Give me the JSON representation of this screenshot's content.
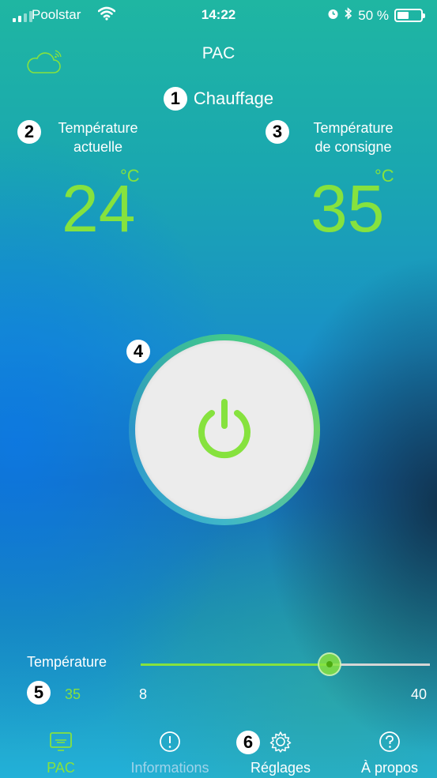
{
  "status": {
    "carrier": "Poolstar",
    "time": "14:22",
    "battery": "50 %",
    "battery_level_percent": 50
  },
  "header": {
    "title": "PAC",
    "cloud_icon": "cloud-wifi-icon"
  },
  "badges": [
    "1",
    "2",
    "3",
    "4",
    "5",
    "6"
  ],
  "mode": {
    "label": "Chauffage"
  },
  "current_temp": {
    "label_line1": "Température",
    "label_line2": "actuelle",
    "value": "24",
    "unit": "°C"
  },
  "target_temp": {
    "label_line1": "Température",
    "label_line2": "de consigne",
    "value": "35",
    "unit": "°C"
  },
  "power": {
    "icon": "power-icon"
  },
  "slider": {
    "label": "Température",
    "value": 35,
    "value_text": "35",
    "min": 8,
    "min_text": "8",
    "max": 40,
    "max_text": "40"
  },
  "tabs": [
    {
      "label": "PAC",
      "icon": "heat-pump-icon",
      "active": true
    },
    {
      "label": "Informations",
      "icon": "info-icon",
      "active": false
    },
    {
      "label": "Réglages",
      "icon": "gear-icon",
      "active": false
    },
    {
      "label": "À propos",
      "icon": "help-icon",
      "active": false
    }
  ],
  "colors": {
    "accent": "#86e23e",
    "text": "#ffffff",
    "button": "#ececec",
    "inactive_tab": "#9fd3ea"
  }
}
